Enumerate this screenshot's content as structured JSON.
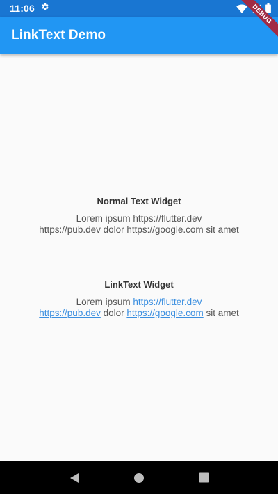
{
  "status_bar": {
    "time": "11:06",
    "icons": [
      "settings-gear",
      "wifi",
      "signal",
      "battery"
    ]
  },
  "app_bar": {
    "title": "LinkText Demo"
  },
  "debug_banner": {
    "label": "DEBUG"
  },
  "normal_section": {
    "heading": "Normal Text Widget",
    "line1": "Lorem ipsum https://flutter.dev",
    "line2": "https://pub.dev dolor https://google.com sit amet"
  },
  "link_section": {
    "heading": "LinkText Widget",
    "text_lorem": "Lorem ipsum ",
    "link_flutter": "https://flutter.dev",
    "link_pub": "https://pub.dev",
    "text_dolor": " dolor ",
    "link_google": "https://google.com",
    "text_sit": " sit amet"
  },
  "nav_bar": {
    "buttons": [
      "back",
      "home",
      "recents"
    ]
  },
  "colors": {
    "status_bar": "#1976d2",
    "app_bar": "#2196f3",
    "link": "#3b8fe0",
    "debug": "#a12b45",
    "background": "#fafafa"
  }
}
